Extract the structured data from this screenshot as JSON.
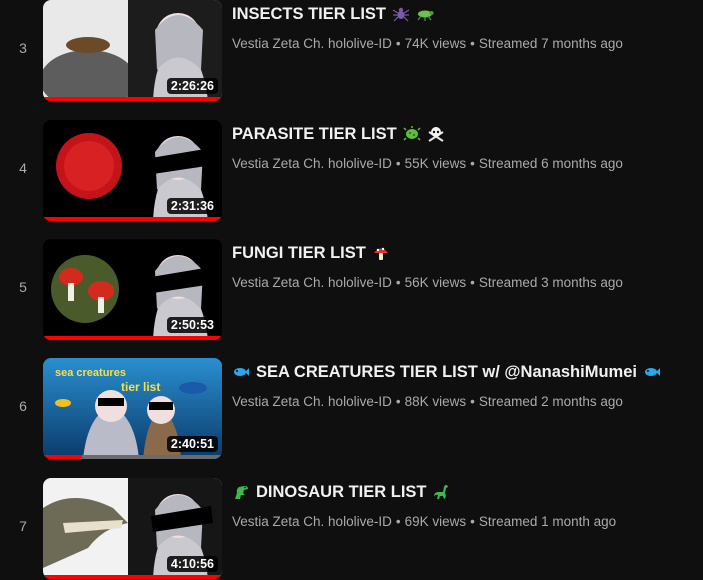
{
  "videos": [
    {
      "index": "3",
      "title": "INSECTS TIER LIST",
      "title_icons": [
        "spider-icon",
        "cricket-icon"
      ],
      "channel": "Vestia Zeta Ch. hololive-ID",
      "views": "74K views",
      "age": "Streamed 7 months ago",
      "duration": "2:26:26",
      "watched_fraction": 1.0
    },
    {
      "index": "4",
      "title": "PARASITE TIER LIST",
      "title_icons": [
        "microbe-icon",
        "skull-crossbones-icon"
      ],
      "channel": "Vestia Zeta Ch. hololive-ID",
      "views": "55K views",
      "age": "Streamed 6 months ago",
      "duration": "2:31:36",
      "watched_fraction": 1.0
    },
    {
      "index": "5",
      "title": "FUNGI TIER LIST",
      "title_icons": [
        "mushroom-icon"
      ],
      "channel": "Vestia Zeta Ch. hololive-ID",
      "views": "56K views",
      "age": "Streamed 3 months ago",
      "duration": "2:50:53",
      "watched_fraction": 1.0
    },
    {
      "index": "6",
      "title": "SEA CREATURES TIER LIST w/ @NanashiMumei",
      "title_icons": [
        "fish-icon",
        "fish-icon"
      ],
      "thumb_text": [
        "sea creatures",
        "tier list"
      ],
      "channel": "Vestia Zeta Ch. hololive-ID",
      "views": "88K views",
      "age": "Streamed 2 months ago",
      "duration": "2:40:51",
      "watched_fraction": 0.22
    },
    {
      "index": "7",
      "title": "DINOSAUR TIER LIST",
      "title_icons": [
        "t-rex-icon",
        "sauropod-icon"
      ],
      "channel": "Vestia Zeta Ch. hololive-ID",
      "views": "69K views",
      "age": "Streamed 1 month ago",
      "duration": "4:10:56",
      "watched_fraction": 1.0
    }
  ],
  "colors": {
    "background": "#0f0f0f",
    "title": "#f1f1f1",
    "meta": "#aaaaaa",
    "progress": "#ff0000"
  }
}
